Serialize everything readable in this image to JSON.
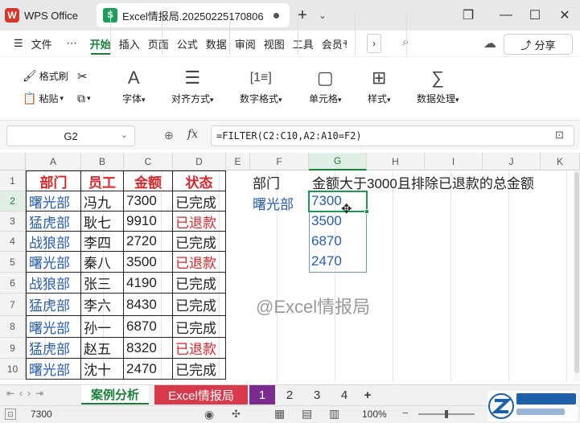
{
  "titlebar": {
    "app_name": "WPS Office",
    "app_logo": "W",
    "doc_tab": "Excel情报局.20250225170806",
    "doc_logo": "S",
    "add_tab": "+",
    "restore": "❐",
    "minimize": "—",
    "maximize": "☐",
    "close": "✕"
  },
  "menubar": {
    "file": "文件",
    "more": "⋯",
    "items": [
      "开始",
      "插入",
      "页面",
      "公式",
      "数据",
      "审阅",
      "视图",
      "工具",
      "会员专享"
    ],
    "share": "分享"
  },
  "ribbon": {
    "format_painter": "格式刷",
    "paste": "粘贴",
    "font": "字体",
    "align": "对齐方式",
    "number_format": "数字格式",
    "cell": "单元格",
    "style": "样式",
    "data_process": "数据处理"
  },
  "formula_bar": {
    "cell_ref": "G2",
    "fx": "fx",
    "formula": "=FILTER(C2:C10,A2:A10=F2)"
  },
  "columns": [
    "A",
    "B",
    "C",
    "D",
    "E",
    "F",
    "G",
    "H",
    "I",
    "J",
    "K"
  ],
  "rows": [
    "1",
    "2",
    "3",
    "4",
    "5",
    "6",
    "7",
    "8",
    "9",
    "10"
  ],
  "table": {
    "headers": [
      "部门",
      "员工",
      "金额",
      "状态"
    ],
    "rows": [
      [
        "曙光部",
        "冯九",
        "7300",
        "已完成"
      ],
      [
        "猛虎部",
        "耿七",
        "9910",
        "已退款"
      ],
      [
        "战狼部",
        "李四",
        "2720",
        "已完成"
      ],
      [
        "曙光部",
        "秦八",
        "3500",
        "已退款"
      ],
      [
        "战狼部",
        "张三",
        "4190",
        "已完成"
      ],
      [
        "猛虎部",
        "李六",
        "8430",
        "已完成"
      ],
      [
        "曙光部",
        "孙一",
        "6870",
        "已完成"
      ],
      [
        "猛虎部",
        "赵五",
        "8320",
        "已退款"
      ],
      [
        "曙光部",
        "沈十",
        "2470",
        "已完成"
      ]
    ]
  },
  "side": {
    "f1": "部门",
    "g1": "金额大于3000且排除已退款的总金额",
    "f2": "曙光部",
    "results": [
      "7300",
      "3500",
      "6870",
      "2470"
    ]
  },
  "watermark": "@Excel情报局",
  "sheet_tabs": {
    "active": "案例分析",
    "second": "Excel情报局",
    "nums": [
      "1",
      "2",
      "3",
      "4"
    ],
    "add": "+"
  },
  "statusbar": {
    "value": "7300",
    "zoom": "100%"
  },
  "colors": {
    "accent": "#1a7f3a",
    "red": "#d8262b",
    "blue": "#2a5caa",
    "tab_red": "#d83a4c",
    "tab_purple": "#7b2b8e"
  }
}
